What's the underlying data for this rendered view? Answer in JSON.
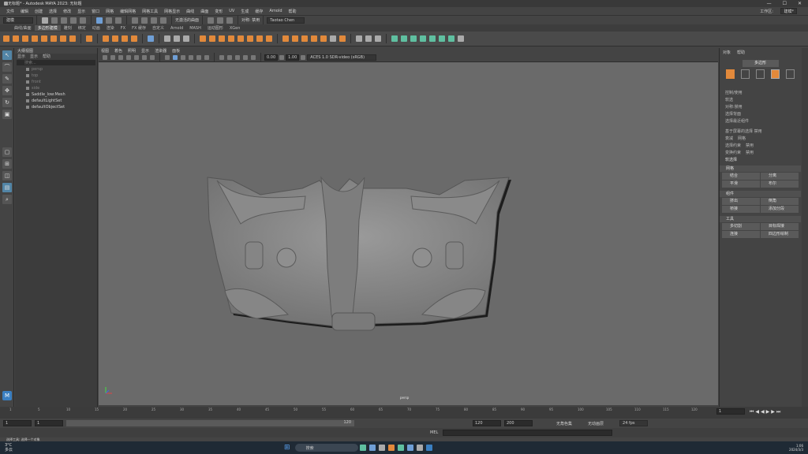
{
  "window": {
    "title": "无标题* - Autodesk MAYA 2023: 无标题",
    "controls": [
      "—",
      "☐",
      "✕"
    ]
  },
  "menu": {
    "items": [
      "文件",
      "编辑",
      "创建",
      "选择",
      "修改",
      "显示",
      "窗口",
      "网格",
      "编辑网格",
      "网格工具",
      "网格显示",
      "曲线",
      "曲面",
      "变形",
      "UV",
      "生成",
      "缓存",
      "Arnold",
      "帮助"
    ],
    "workspace_label": "工作区:",
    "workspace_value": "建模*"
  },
  "status": {
    "mode": "建模",
    "symmetry": "对称: 禁用",
    "user": "Taotao Chen",
    "live": "无激活的曲面"
  },
  "shelf_tabs": [
    "曲线/曲面",
    "多边形建模",
    "雕刻",
    "绑定",
    "动画",
    "渲染",
    "FX",
    "FX 缓存",
    "自定义",
    "Arnold",
    "MASH",
    "运动图形",
    "XGen"
  ],
  "shelf_active": 1,
  "outliner": {
    "title": "大纲视图",
    "menus": [
      "显示",
      "显示",
      "帮助"
    ],
    "search": "搜索...",
    "items": [
      {
        "label": "persp",
        "dim": true
      },
      {
        "label": "top",
        "dim": true
      },
      {
        "label": "front",
        "dim": true
      },
      {
        "label": "side",
        "dim": true
      },
      {
        "label": "Saddle_low:Mesh",
        "dim": false
      },
      {
        "label": "defaultLightSet",
        "dim": false
      },
      {
        "label": "defaultObjectSet",
        "dim": false
      }
    ]
  },
  "viewport": {
    "menus": [
      "视图",
      "着色",
      "照明",
      "显示",
      "渲染器",
      "面板"
    ],
    "num1": "0.00",
    "num2": "1.00",
    "colorspace": "ACES 1.0 SDR-video (sRGB)",
    "camera": "persp"
  },
  "attr": {
    "tabs": [
      "对象",
      "帮助"
    ],
    "mode": "多边形",
    "options": [
      "控制/使用",
      "软选",
      "对称:禁用",
      "选择背面",
      "选择最近组件"
    ],
    "pick": "基于屏幕的选择",
    "pick_value": "禁用",
    "rows": [
      [
        "衰减",
        "网格"
      ],
      [
        "选择约束",
        "禁用"
      ],
      [
        "变换约束",
        "禁用"
      ]
    ],
    "collapsed": "软选择",
    "sections": [
      {
        "title": "网格",
        "buttons": [
          "结合",
          "分离",
          "平滑",
          "布尔"
        ]
      },
      {
        "title": "组件",
        "buttons": [
          "挤出",
          "倒角",
          "桥接",
          "添加分段"
        ]
      },
      {
        "title": "工具",
        "buttons": [
          "多切割",
          "目标焊接",
          "连接",
          "四边形绘制"
        ]
      }
    ]
  },
  "timeline": {
    "ticks": [
      "1",
      "5",
      "10",
      "15",
      "20",
      "25",
      "30",
      "35",
      "40",
      "45",
      "50",
      "55",
      "60",
      "65",
      "70",
      "75",
      "80",
      "85",
      "90",
      "95",
      "100",
      "105",
      "110",
      "115",
      "120"
    ],
    "current": "1"
  },
  "range": {
    "start": "1",
    "start2": "1",
    "end": "120",
    "end2": "120",
    "max": "200",
    "char_set": "无角色集",
    "anim_layer": "无动画层",
    "fps": "24 fps"
  },
  "cmd": {
    "label": "MEL",
    "help": "选择工具: 选择一个对象"
  },
  "taskbar": {
    "weather": "3°C",
    "weather_sub": "多云",
    "search": "搜索",
    "time": "1:06",
    "date": "2024/3/3"
  }
}
